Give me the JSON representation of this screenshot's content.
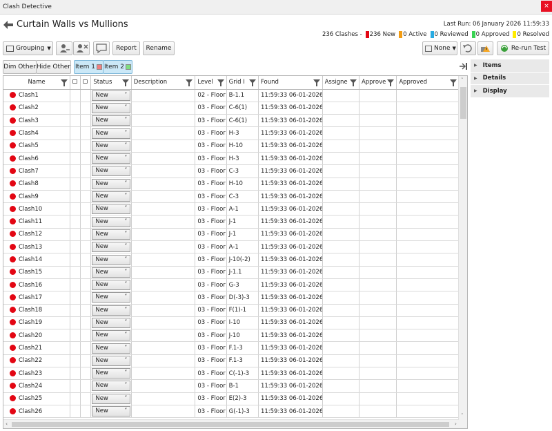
{
  "window": {
    "title": "Clash Detective",
    "close": "×"
  },
  "test": {
    "name": "Curtain Walls vs Mullions",
    "last_run": "Last Run: 06 January 2026 11:59:33"
  },
  "summary": {
    "clashes": "236 Clashes -",
    "new": "236 New",
    "active": "0 Active",
    "reviewed": "0 Reviewed",
    "approved": "0 Approved",
    "resolved": "0 Resolved",
    "colors": {
      "new": "#e30613",
      "active": "#f39c12",
      "reviewed": "#29abe2",
      "approved": "#39d353",
      "resolved": "#ffeb00"
    }
  },
  "toolbar": {
    "grouping": "Grouping",
    "report": "Report",
    "rename": "Rename",
    "none": "None",
    "rerun": "Re-run Test"
  },
  "filterbar": {
    "dim_other": "Dim Other",
    "hide_other": "Hide Other",
    "item1": "Item 1",
    "item2": "Item 2",
    "item1_color": "#f08080",
    "item2_color": "#7fdd7f"
  },
  "columns": {
    "name": "Name",
    "status": "Status",
    "description": "Description",
    "level": "Level",
    "grid": "Grid I",
    "found": "Found",
    "assigned": "Assigne",
    "approvedby": "Approve",
    "approved": "Approved"
  },
  "rows": [
    {
      "name": "Clash1",
      "status": "New",
      "level": "02 - Floor",
      "grid": "B-1.1",
      "found": "11:59:33 06-01-2026"
    },
    {
      "name": "Clash2",
      "status": "New",
      "level": "03 - Floor",
      "grid": "C-6(1)",
      "found": "11:59:33 06-01-2026"
    },
    {
      "name": "Clash3",
      "status": "New",
      "level": "03 - Floor",
      "grid": "C-6(1)",
      "found": "11:59:33 06-01-2026"
    },
    {
      "name": "Clash4",
      "status": "New",
      "level": "03 - Floor",
      "grid": "H-3",
      "found": "11:59:33 06-01-2026"
    },
    {
      "name": "Clash5",
      "status": "New",
      "level": "03 - Floor",
      "grid": "H-10",
      "found": "11:59:33 06-01-2026"
    },
    {
      "name": "Clash6",
      "status": "New",
      "level": "03 - Floor",
      "grid": "H-3",
      "found": "11:59:33 06-01-2026"
    },
    {
      "name": "Clash7",
      "status": "New",
      "level": "03 - Floor",
      "grid": "C-3",
      "found": "11:59:33 06-01-2026"
    },
    {
      "name": "Clash8",
      "status": "New",
      "level": "03 - Floor",
      "grid": "H-10",
      "found": "11:59:33 06-01-2026"
    },
    {
      "name": "Clash9",
      "status": "New",
      "level": "03 - Floor",
      "grid": "C-3",
      "found": "11:59:33 06-01-2026"
    },
    {
      "name": "Clash10",
      "status": "New",
      "level": "03 - Floor",
      "grid": "A-1",
      "found": "11:59:33 06-01-2026"
    },
    {
      "name": "Clash11",
      "status": "New",
      "level": "03 - Floor",
      "grid": "J-1",
      "found": "11:59:33 06-01-2026"
    },
    {
      "name": "Clash12",
      "status": "New",
      "level": "03 - Floor",
      "grid": "J-1",
      "found": "11:59:33 06-01-2026"
    },
    {
      "name": "Clash13",
      "status": "New",
      "level": "03 - Floor",
      "grid": "A-1",
      "found": "11:59:33 06-01-2026"
    },
    {
      "name": "Clash14",
      "status": "New",
      "level": "03 - Floor",
      "grid": "J-10(-2)",
      "found": "11:59:33 06-01-2026"
    },
    {
      "name": "Clash15",
      "status": "New",
      "level": "03 - Floor",
      "grid": "J-1.1",
      "found": "11:59:33 06-01-2026"
    },
    {
      "name": "Clash16",
      "status": "New",
      "level": "03 - Floor",
      "grid": "G-3",
      "found": "11:59:33 06-01-2026"
    },
    {
      "name": "Clash17",
      "status": "New",
      "level": "03 - Floor",
      "grid": "D(-3)-3",
      "found": "11:59:33 06-01-2026"
    },
    {
      "name": "Clash18",
      "status": "New",
      "level": "03 - Floor",
      "grid": "F(1)-1",
      "found": "11:59:33 06-01-2026"
    },
    {
      "name": "Clash19",
      "status": "New",
      "level": "03 - Floor",
      "grid": "I-10",
      "found": "11:59:33 06-01-2026"
    },
    {
      "name": "Clash20",
      "status": "New",
      "level": "03 - Floor",
      "grid": "J-10",
      "found": "11:59:33 06-01-2026"
    },
    {
      "name": "Clash21",
      "status": "New",
      "level": "03 - Floor",
      "grid": "F.1-3",
      "found": "11:59:33 06-01-2026"
    },
    {
      "name": "Clash22",
      "status": "New",
      "level": "03 - Floor",
      "grid": "F.1-3",
      "found": "11:59:33 06-01-2026"
    },
    {
      "name": "Clash23",
      "status": "New",
      "level": "03 - Floor",
      "grid": "C(-1)-3",
      "found": "11:59:33 06-01-2026"
    },
    {
      "name": "Clash24",
      "status": "New",
      "level": "03 - Floor",
      "grid": "B-1",
      "found": "11:59:33 06-01-2026"
    },
    {
      "name": "Clash25",
      "status": "New",
      "level": "03 - Floor",
      "grid": "E(2)-3",
      "found": "11:59:33 06-01-2026"
    },
    {
      "name": "Clash26",
      "status": "New",
      "level": "03 - Floor",
      "grid": "G(-1)-3",
      "found": "11:59:33 06-01-2026"
    }
  ],
  "panel": {
    "items": "Items",
    "details": "Details",
    "display": "Display"
  }
}
